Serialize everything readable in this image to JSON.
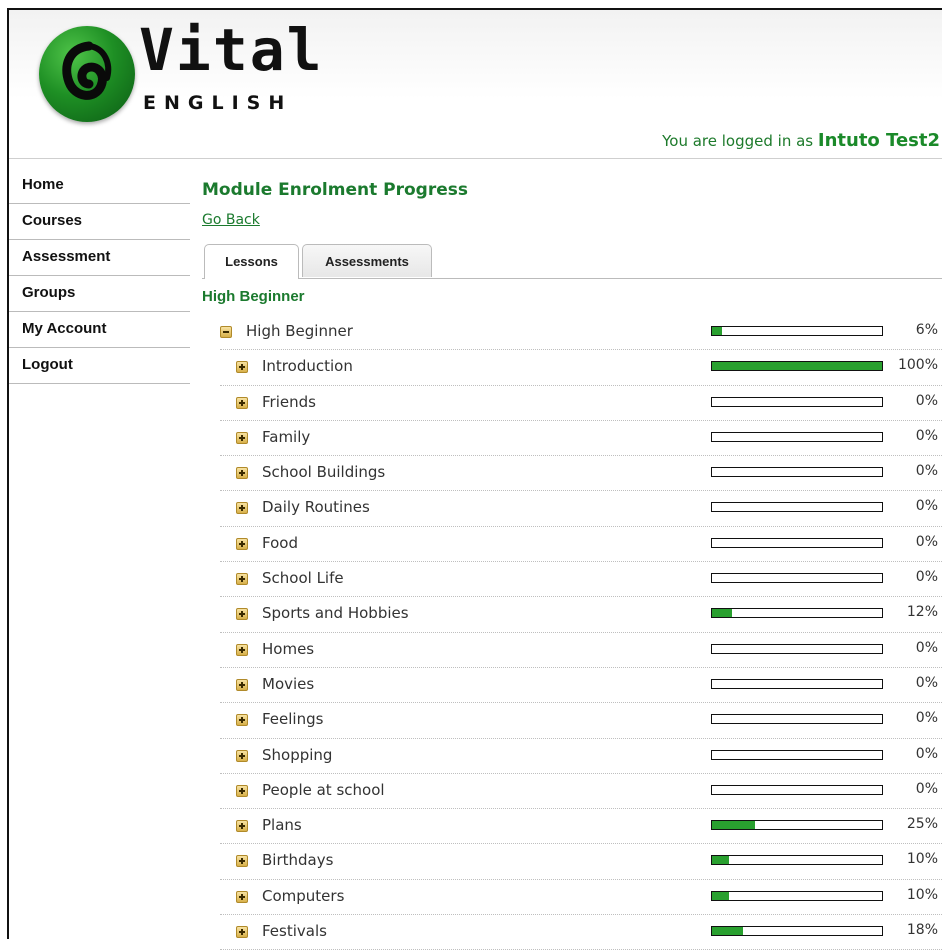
{
  "logo": {
    "word": "Vital",
    "sub": "ENGLISH"
  },
  "header": {
    "login_prefix": "You are logged in as",
    "user_name": "Intuto Test2"
  },
  "nav": {
    "items": [
      {
        "label": "Home"
      },
      {
        "label": "Courses"
      },
      {
        "label": "Assessment"
      },
      {
        "label": "Groups"
      },
      {
        "label": "My Account"
      },
      {
        "label": "Logout"
      }
    ]
  },
  "main": {
    "title": "Module Enrolment Progress",
    "go_back": "Go Back",
    "tabs": [
      {
        "label": "Lessons",
        "active": true
      },
      {
        "label": "Assessments",
        "active": false
      }
    ],
    "section_title": "High Beginner"
  },
  "colors": {
    "progress_fill": "#29a02f",
    "title_green": "#1b7a2e"
  },
  "lessons": [
    {
      "label": "High Beginner",
      "progress": 6,
      "pct": "6%",
      "expanded": true,
      "level": 0
    },
    {
      "label": "Introduction",
      "progress": 100,
      "pct": "100%",
      "expanded": false,
      "level": 1
    },
    {
      "label": "Friends",
      "progress": 0,
      "pct": "0%",
      "expanded": false,
      "level": 1
    },
    {
      "label": "Family",
      "progress": 0,
      "pct": "0%",
      "expanded": false,
      "level": 1
    },
    {
      "label": "School Buildings",
      "progress": 0,
      "pct": "0%",
      "expanded": false,
      "level": 1
    },
    {
      "label": "Daily Routines",
      "progress": 0,
      "pct": "0%",
      "expanded": false,
      "level": 1
    },
    {
      "label": "Food",
      "progress": 0,
      "pct": "0%",
      "expanded": false,
      "level": 1
    },
    {
      "label": "School Life",
      "progress": 0,
      "pct": "0%",
      "expanded": false,
      "level": 1
    },
    {
      "label": "Sports and Hobbies",
      "progress": 12,
      "pct": "12%",
      "expanded": false,
      "level": 1
    },
    {
      "label": "Homes",
      "progress": 0,
      "pct": "0%",
      "expanded": false,
      "level": 1
    },
    {
      "label": "Movies",
      "progress": 0,
      "pct": "0%",
      "expanded": false,
      "level": 1
    },
    {
      "label": "Feelings",
      "progress": 0,
      "pct": "0%",
      "expanded": false,
      "level": 1
    },
    {
      "label": "Shopping",
      "progress": 0,
      "pct": "0%",
      "expanded": false,
      "level": 1
    },
    {
      "label": "People at school",
      "progress": 0,
      "pct": "0%",
      "expanded": false,
      "level": 1
    },
    {
      "label": "Plans",
      "progress": 25,
      "pct": "25%",
      "expanded": false,
      "level": 1
    },
    {
      "label": "Birthdays",
      "progress": 10,
      "pct": "10%",
      "expanded": false,
      "level": 1
    },
    {
      "label": "Computers",
      "progress": 10,
      "pct": "10%",
      "expanded": false,
      "level": 1
    },
    {
      "label": "Festivals",
      "progress": 18,
      "pct": "18%",
      "expanded": false,
      "level": 1
    }
  ]
}
